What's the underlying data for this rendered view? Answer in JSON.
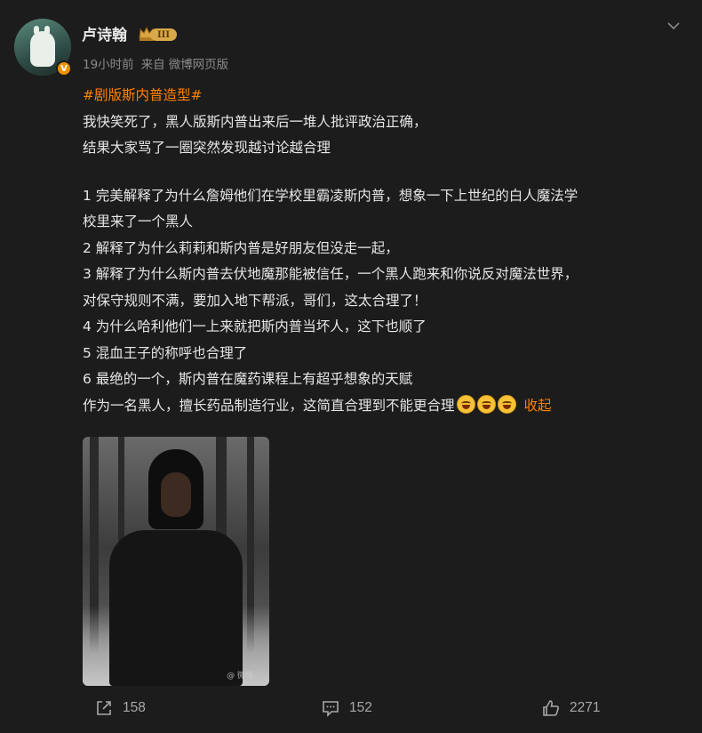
{
  "author": {
    "name": "卢诗翰",
    "verified_badge": "V",
    "vip_level": "III"
  },
  "meta": {
    "time": "19小时前",
    "source_prefix": "来自",
    "source": "微博网页版"
  },
  "post": {
    "topic": "#剧版斯内普造型#",
    "lines": [
      "我快笑死了，黑人版斯内普出来后一堆人批评政治正确，",
      "结果大家骂了一圈突然发现越讨论越合理",
      "",
      "1 完美解释了为什么詹姆他们在学校里霸凌斯内普，想象一下上世纪的白人魔法学",
      "校里来了一个黑人",
      "2 解释了为什么莉莉和斯内普是好朋友但没走一起，",
      "3 解释了为什么斯内普去伏地魔那能被信任，一个黑人跑来和你说反对魔法世界，",
      "对保守规则不满，要加入地下帮派，哥们，这太合理了！",
      "4 为什么哈利他们一上来就把斯内普当坏人，这下也顺了",
      "5 混血王子的称呼也合理了",
      "6 最绝的一个，斯内普在魔药课程上有超乎想象的天赋"
    ],
    "last_line": "作为一名黑人，擅长药品制造行业，这简直合理到不能更合理",
    "emoji_name": "laugh-cry-emoji",
    "collapse_label": "收起",
    "image_watermark": "@ 微博"
  },
  "actions": {
    "share_count": "158",
    "comment_count": "152",
    "like_count": "2271"
  },
  "colors": {
    "background": "#1c1c1c",
    "accent": "#ff8200",
    "text": "#e6e6e6",
    "muted": "#8a8a8a"
  }
}
